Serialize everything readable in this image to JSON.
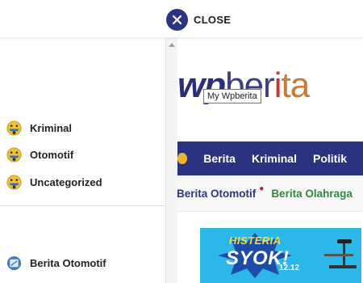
{
  "topbar": {
    "close_label": "CLOSE",
    "close_icon": "close-icon",
    "accent_color": "#2b3585"
  },
  "drawer": {
    "categories": [
      {
        "label": "Kriminal",
        "icon": "category-emoji-icon"
      },
      {
        "label": "Otomotif",
        "icon": "category-emoji-icon"
      },
      {
        "label": "Uncategorized",
        "icon": "category-emoji-icon"
      }
    ],
    "recent": [
      {
        "label": "Berita Otomotif",
        "icon": "article-icon"
      }
    ]
  },
  "site": {
    "logo_part1": "wp",
    "logo_part2_pre": "ber",
    "logo_part2_mid": "i",
    "logo_part2_post": "ta",
    "tooltip": "My Wpberita",
    "nav_items": [
      "Berita",
      "Kriminal",
      "Politik"
    ],
    "sub_items": [
      "Berita Otomotif",
      "Berita Olahraga"
    ],
    "nav_color": "#2b3280",
    "banner": {
      "title1": "HISTERIA",
      "title2": "SYOK!",
      "date": "12.12"
    }
  }
}
